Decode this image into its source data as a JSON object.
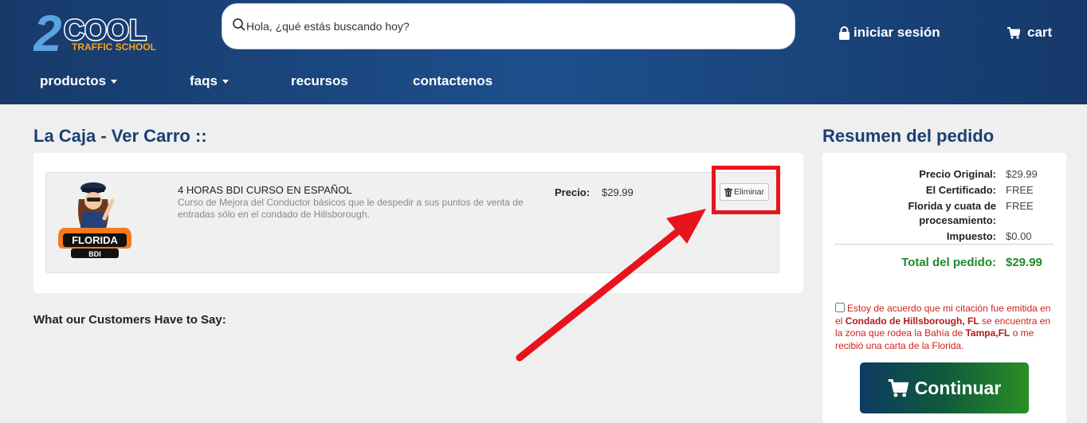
{
  "header": {
    "logo_main": "2COOL",
    "logo_sub": "TRAFFIC SCHOOL",
    "search_placeholder": "Hola, ¿qué estás buscando hoy?",
    "login_label": "iniciar sesión",
    "cart_label": "cart",
    "nav": [
      {
        "label": "productos",
        "dropdown": true
      },
      {
        "label": "faqs",
        "dropdown": true
      },
      {
        "label": "recursos",
        "dropdown": false
      },
      {
        "label": "contactenos",
        "dropdown": false
      }
    ]
  },
  "cart": {
    "title": "La Caja - Ver Carro ::",
    "item": {
      "badge_text": "FLORIDA",
      "badge_sub": "BDI",
      "name": "4 HORAS BDI CURSO EN ESPAÑOL",
      "description": "Curso de Mejora del Conductor básicos que le despedir a sus puntos de venta de entradas sólo en el condado de Hillsborough.",
      "price_label": "Precio:",
      "price": "$29.99",
      "delete_label": "Eliminar"
    },
    "customers_heading": "What our Customers Have to Say:"
  },
  "summary": {
    "title": "Resumen del pedido",
    "rows": [
      {
        "label": "Precio Original:",
        "value": "$29.99"
      },
      {
        "label": "El Certificado:",
        "value": "FREE"
      },
      {
        "label_line1": "Florida y cuata de",
        "label_line2": "procesamiento:",
        "value": "FREE"
      },
      {
        "label": "Impuesto:",
        "value": "$0.00"
      }
    ],
    "total_label": "Total del pedido:",
    "total_value": "$29.99",
    "agree_text_1": "Estoy de acuerdo que mi citación fue emitida en el ",
    "agree_bold_1": "Condado de Hillsborough, FL",
    "agree_text_2": " se encuentra en la zona que rodea la Bahía de ",
    "agree_bold_2": "Tampa,FL",
    "agree_text_3": " o me recibió una carta de la Florida.",
    "continue_label": "Continuar"
  },
  "colors": {
    "header_blue": "#1d4f8c",
    "title_blue": "#1b3f72",
    "total_green": "#1e8a2c",
    "highlight_red": "#e8141c"
  }
}
